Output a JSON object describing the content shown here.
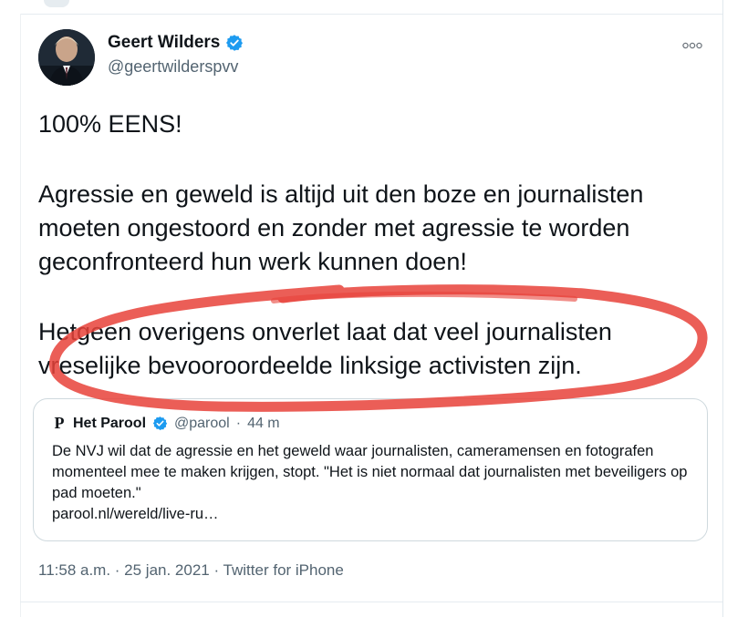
{
  "tweet": {
    "author_name": "Geert Wilders",
    "author_handle": "@geertwilderspvv",
    "more_icon": "more-icon",
    "paragraphs": [
      "100% EENS!",
      "Agressie en geweld is altijd uit den boze en journalisten moeten ongestoord en zonder met agressie te worden geconfronteerd hun werk kunnen doen!",
      "Hetgeen overigens onverlet laat dat veel journalisten vreselijke bevooroordeelde linksige activisten zijn."
    ],
    "timestamp": "11:58 a.m. · 25 jan. 2021 · Twitter for iPhone"
  },
  "quoted": {
    "logo": "P",
    "name": "Het Parool",
    "handle": "@parool",
    "separator": "·",
    "time": "44 m",
    "text": "De NVJ wil dat de agressie en het geweld waar journalisten, cameramensen en fotografen momenteel mee te maken krijgen, stopt. \"Het is niet normaal dat journalisten met beveiligers op pad moeten.\"",
    "link": "parool.nl/wereld/live-ru…"
  },
  "colors": {
    "verified": "#1d9bf0",
    "annotation": "#e8423a",
    "secondary_text": "#536471"
  }
}
